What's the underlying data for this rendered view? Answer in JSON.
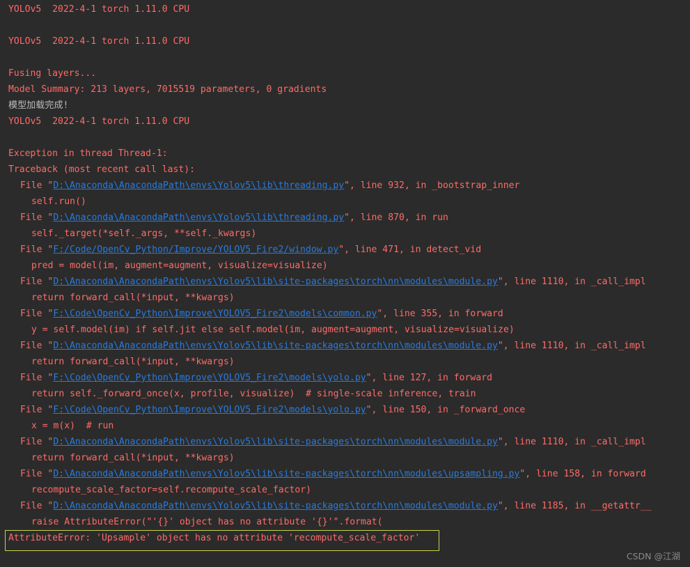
{
  "console": {
    "header": [
      "YOLOv5  2022-4-1 torch 1.11.0 CPU",
      "YOLOv5  2022-4-1 torch 1.11.0 CPU",
      "Fusing layers...",
      "Model Summary: 213 layers, 7015519 parameters, 0 gradients",
      "模型加载完成!",
      "YOLOv5  2022-4-1 torch 1.11.0 CPU",
      "Exception in thread Thread-1:",
      "Traceback (most recent call last):"
    ],
    "frames": [
      {
        "prefix": "File \"",
        "path": "D:\\Anaconda\\AnacondaPath\\envs\\Yolov5\\lib\\threading.py",
        "suffix": "\", line 932, in _bootstrap_inner",
        "code": "self.run()"
      },
      {
        "prefix": "File \"",
        "path": "D:\\Anaconda\\AnacondaPath\\envs\\Yolov5\\lib\\threading.py",
        "suffix": "\", line 870, in run",
        "code": "self._target(*self._args, **self._kwargs)"
      },
      {
        "prefix": "File \"",
        "path": "F:/Code/OpenCv_Python/Improve/YOLOV5_Fire2/window.py",
        "suffix": "\", line 471, in detect_vid",
        "code": "pred = model(im, augment=augment, visualize=visualize)"
      },
      {
        "prefix": "File \"",
        "path": "D:\\Anaconda\\AnacondaPath\\envs\\Yolov5\\lib\\site-packages\\torch\\nn\\modules\\module.py",
        "suffix": "\", line 1110, in _call_impl",
        "code": "return forward_call(*input, **kwargs)"
      },
      {
        "prefix": "File \"",
        "path": "F:\\Code\\OpenCv_Python\\Improve\\YOLOV5_Fire2\\models\\common.py",
        "suffix": "\", line 355, in forward",
        "code": "y = self.model(im) if self.jit else self.model(im, augment=augment, visualize=visualize)"
      },
      {
        "prefix": "File \"",
        "path": "D:\\Anaconda\\AnacondaPath\\envs\\Yolov5\\lib\\site-packages\\torch\\nn\\modules\\module.py",
        "suffix": "\", line 1110, in _call_impl",
        "code": "return forward_call(*input, **kwargs)"
      },
      {
        "prefix": "File \"",
        "path": "F:\\Code\\OpenCv_Python\\Improve\\YOLOV5_Fire2\\models\\yolo.py",
        "suffix": "\", line 127, in forward",
        "code": "return self._forward_once(x, profile, visualize)  # single-scale inference, train"
      },
      {
        "prefix": "File \"",
        "path": "F:\\Code\\OpenCv_Python\\Improve\\YOLOV5_Fire2\\models\\yolo.py",
        "suffix": "\", line 150, in _forward_once",
        "code": "x = m(x)  # run"
      },
      {
        "prefix": "File \"",
        "path": "D:\\Anaconda\\AnacondaPath\\envs\\Yolov5\\lib\\site-packages\\torch\\nn\\modules\\module.py",
        "suffix": "\", line 1110, in _call_impl",
        "code": "return forward_call(*input, **kwargs)"
      },
      {
        "prefix": "File \"",
        "path": "D:\\Anaconda\\AnacondaPath\\envs\\Yolov5\\lib\\site-packages\\torch\\nn\\modules\\upsampling.py",
        "suffix": "\", line 158, in forward",
        "code": "recompute_scale_factor=self.recompute_scale_factor)"
      },
      {
        "prefix": "File \"",
        "path": "D:\\Anaconda\\AnacondaPath\\envs\\Yolov5\\lib\\site-packages\\torch\\nn\\modules\\module.py",
        "suffix": "\", line 1185, in __getattr__",
        "code": "raise AttributeError(\"'{}' object has no attribute '{}'\".format("
      }
    ],
    "error": "AttributeError: 'Upsample' object has no attribute 'recompute_scale_factor'"
  },
  "watermark": "CSDN @江湖",
  "colors": {
    "background": "#2b2b2b",
    "error_text": "#ff6b68",
    "normal_text": "#bbbbbb",
    "link": "#287bde",
    "highlight_border": "#c9d34a"
  }
}
